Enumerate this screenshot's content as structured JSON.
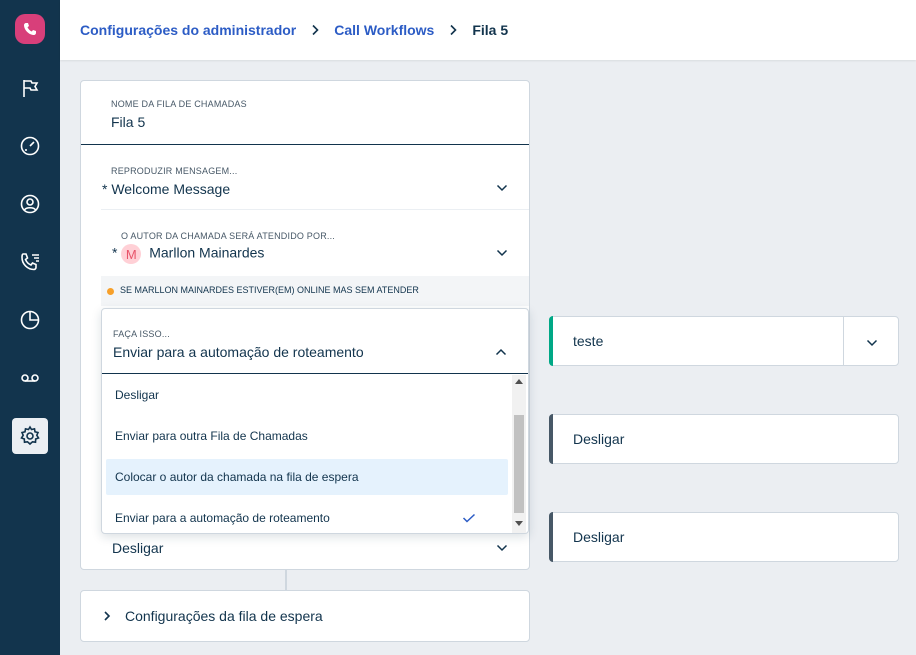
{
  "breadcrumb": {
    "admin": "Configurações do administrador",
    "workflows": "Call Workflows",
    "current": "Fila 5"
  },
  "sidebar": {
    "icons": [
      "phone-icon",
      "flag-icon",
      "dashboard-icon",
      "contact-icon",
      "call-list-icon",
      "reports-icon",
      "voicemail-icon",
      "settings-icon"
    ],
    "active": "settings-icon"
  },
  "queue_card": {
    "name_label": "NOME DA FILA DE CHAMADAS",
    "name_value": "Fila 5",
    "message_label": "REPRODUZIR MENSAGEM...",
    "message_value": "Welcome Message",
    "required_mark": "*",
    "answered_by_label": "O AUTOR DA CHAMADA SERÁ ATENDIDO POR...",
    "answered_by_initial": "M",
    "answered_by_value": "Marllon Mainardes",
    "online_notice": "SE MARLLON MAINARDES ESTIVER(EM) ONLINE MAS SEM ATENDER",
    "hidden_field_value": "Desligar"
  },
  "dropdown": {
    "label": "FAÇA ISSO...",
    "value": "Enviar para a automação de roteamento",
    "options": [
      {
        "label": "Desligar"
      },
      {
        "label": "Enviar para outra Fila de Chamadas"
      },
      {
        "label": "Colocar o autor da chamada na fila de espera"
      },
      {
        "label": "Enviar para a automação de roteamento"
      }
    ],
    "highlighted_index": 2,
    "selected_index": 3
  },
  "right_panels": [
    {
      "value": "teste",
      "accent": "#00a886"
    },
    {
      "value": "Desligar",
      "accent": "#475867"
    },
    {
      "value": "Desligar",
      "accent": "#475867"
    }
  ],
  "waiting_queue": {
    "label": "Configurações da fila de espera"
  },
  "colors": {
    "sidebar": "#12344d",
    "link": "#2c5cc5",
    "brand": "#d83f7a",
    "online_dot": "#f7a02a",
    "highlight": "#e5f2fd"
  }
}
